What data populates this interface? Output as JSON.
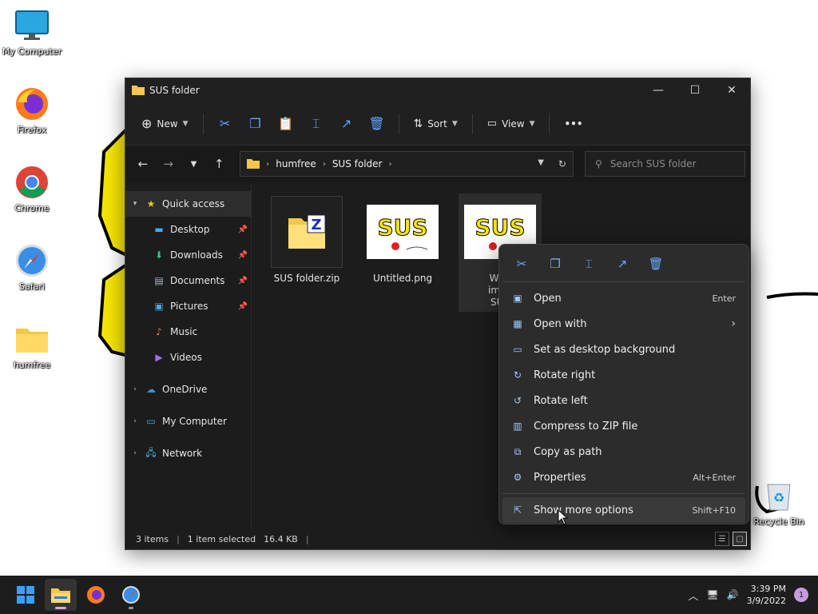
{
  "desktop": {
    "icons": [
      {
        "label": "My Computer",
        "icon": "monitor-icon"
      },
      {
        "label": "Firefox",
        "icon": "firefox-icon"
      },
      {
        "label": "Chrome",
        "icon": "chrome-icon"
      },
      {
        "label": "Safari",
        "icon": "safari-icon"
      },
      {
        "label": "humfree",
        "icon": "folder-icon"
      },
      {
        "label": "Recycle Bin",
        "icon": "recycle-bin-icon"
      }
    ]
  },
  "window": {
    "title": "SUS folder",
    "toolbar": {
      "new_label": "New",
      "sort_label": "Sort",
      "view_label": "View",
      "more_label": "•••"
    },
    "breadcrumb": [
      "humfree",
      "SUS folder"
    ],
    "search_placeholder": "Search SUS folder",
    "sidebar": [
      {
        "label": "Quick access",
        "icon": "star-icon",
        "expander": "▾",
        "pinned": false
      },
      {
        "label": "Desktop",
        "icon": "desktop-icon",
        "expander": "",
        "pinned": true
      },
      {
        "label": "Downloads",
        "icon": "download-icon",
        "expander": "",
        "pinned": true
      },
      {
        "label": "Documents",
        "icon": "document-icon",
        "expander": "",
        "pinned": true
      },
      {
        "label": "Pictures",
        "icon": "pictures-icon",
        "expander": "",
        "pinned": true
      },
      {
        "label": "Music",
        "icon": "music-icon",
        "expander": "",
        "pinned": false
      },
      {
        "label": "Videos",
        "icon": "videos-icon",
        "expander": "",
        "pinned": false
      },
      {
        "label": "OneDrive",
        "icon": "cloud-icon",
        "expander": "›",
        "pinned": false
      },
      {
        "label": "My Computer",
        "icon": "monitor-icon",
        "expander": "›",
        "pinned": false
      },
      {
        "label": "Network",
        "icon": "network-icon",
        "expander": "›",
        "pinned": false
      }
    ],
    "files": [
      {
        "name": "SUS folder.zip",
        "type": "zip"
      },
      {
        "name": "Untitled.png",
        "type": "image"
      },
      {
        "name_lines": [
          "Whe",
          "impo",
          "SUS"
        ],
        "type": "image"
      }
    ],
    "status": {
      "items": "3 items",
      "selected": "1 item selected",
      "size": "16.4 KB"
    }
  },
  "context_menu": {
    "items": [
      {
        "label": "Open",
        "shortcut": "Enter",
        "icon": "image-icon"
      },
      {
        "label": "Open with",
        "shortcut": "›",
        "icon": "open-with-icon"
      },
      {
        "label": "Set as desktop background",
        "shortcut": "",
        "icon": "desktop-background-icon"
      },
      {
        "label": "Rotate right",
        "shortcut": "",
        "icon": "rotate-right-icon"
      },
      {
        "label": "Rotate left",
        "shortcut": "",
        "icon": "rotate-left-icon"
      },
      {
        "label": "Compress to ZIP file",
        "shortcut": "",
        "icon": "zip-icon"
      },
      {
        "label": "Copy as path",
        "shortcut": "",
        "icon": "copy-path-icon"
      },
      {
        "label": "Properties",
        "shortcut": "Alt+Enter",
        "icon": "properties-icon"
      }
    ],
    "more": {
      "label": "Show more options",
      "shortcut": "Shift+F10",
      "icon": "more-options-icon"
    }
  },
  "taskbar": {
    "time": "3:39 PM",
    "date": "3/9/2022",
    "notification_count": "1"
  },
  "colors": {
    "accent": "#60a8ff",
    "window_bg": "#1c1c1c",
    "menu_bg": "#2c2c2c",
    "taskbar_bg": "#1d1d1d"
  }
}
